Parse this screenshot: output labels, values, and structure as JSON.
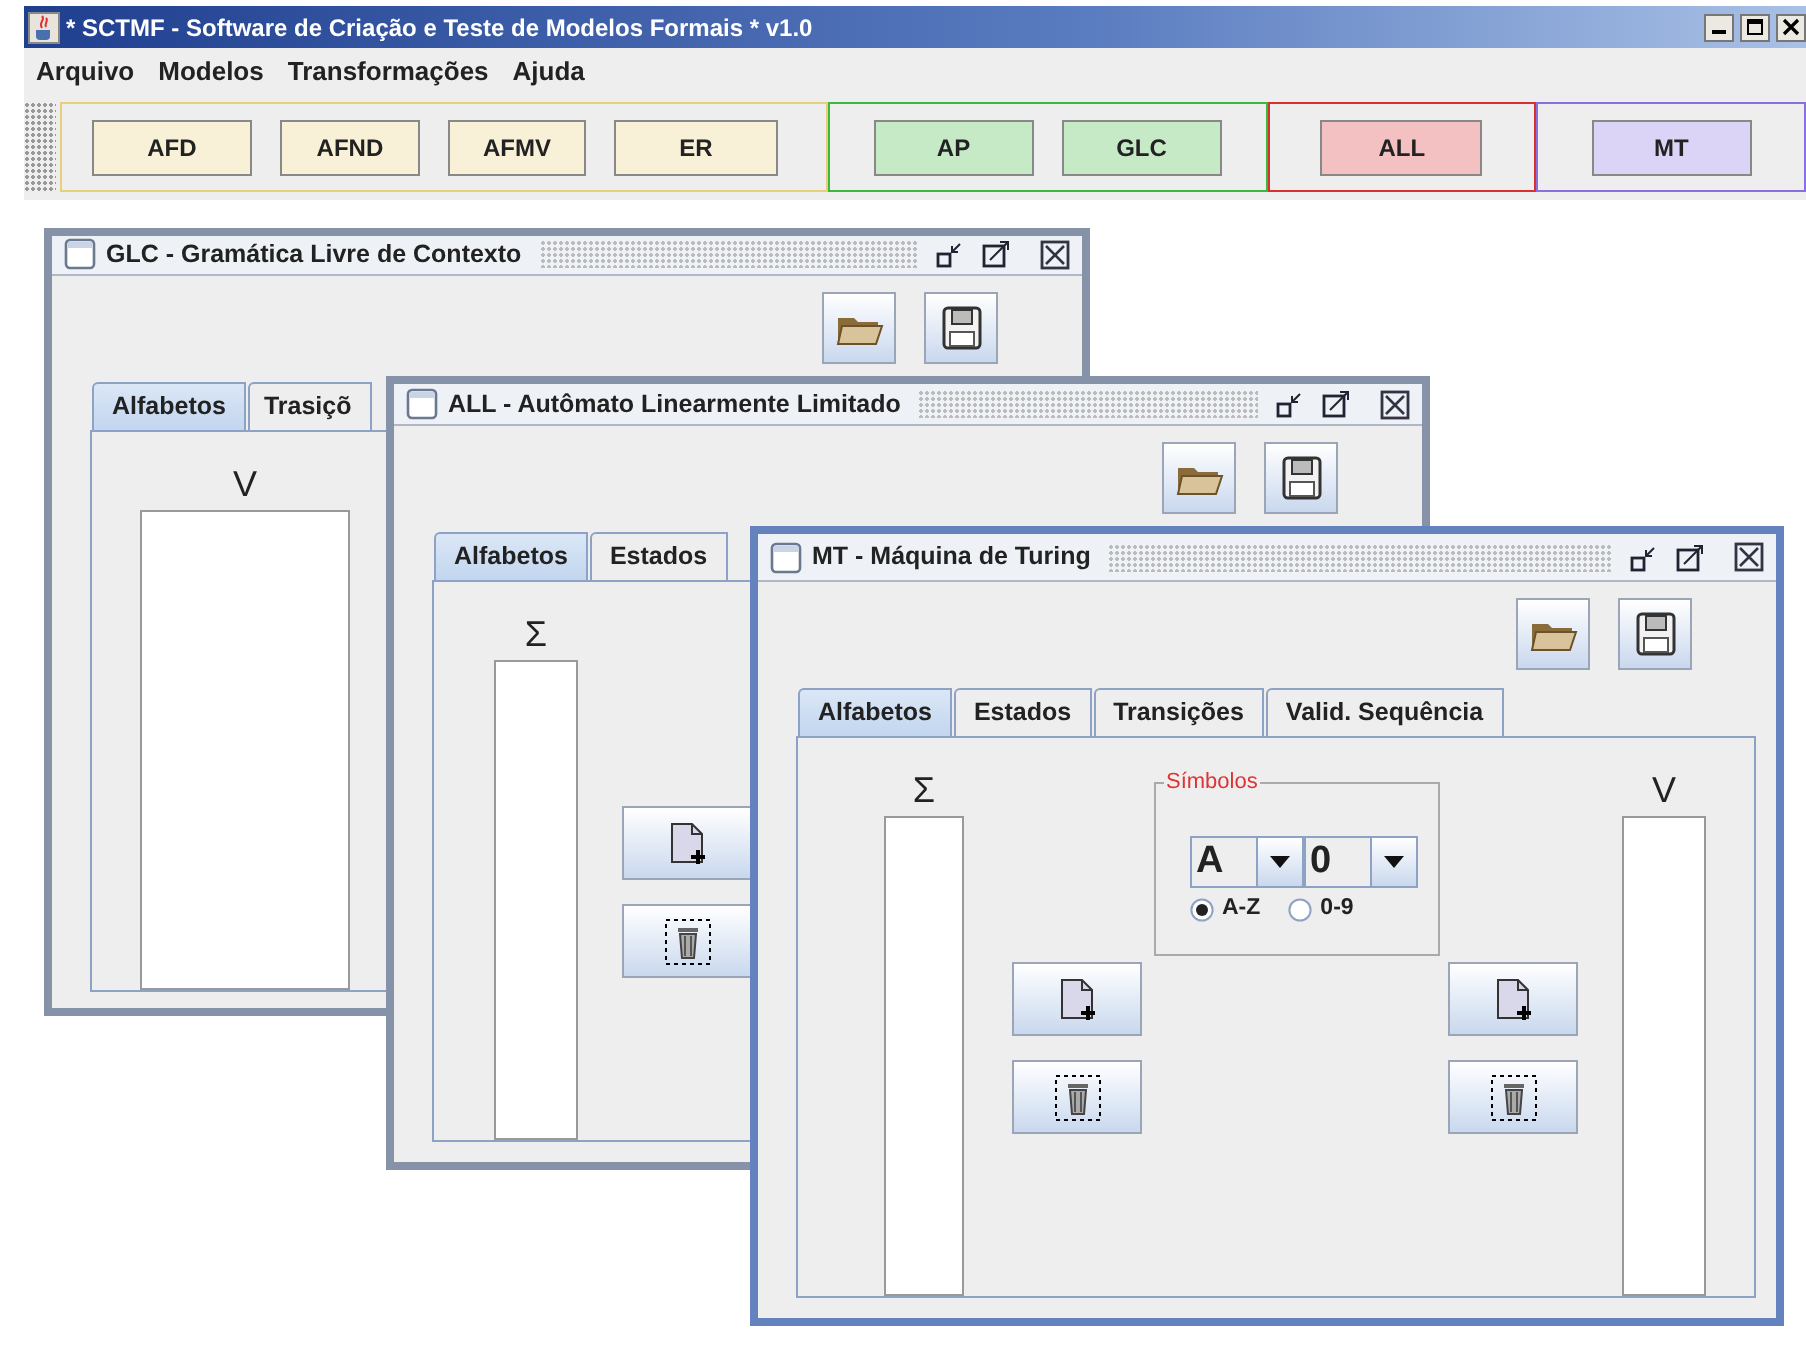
{
  "app": {
    "title": "* SCTMF - Software de Criação e Teste de Modelos Formais * v1.0"
  },
  "menu": [
    "Arquivo",
    "Modelos",
    "Transformações",
    "Ajuda"
  ],
  "toolbar": [
    {
      "color": "#e8cf7a",
      "buttons": [
        "AFD",
        "AFND",
        "AFMV",
        "ER"
      ]
    },
    {
      "color": "#3cb83c",
      "buttons": [
        "AP",
        "GLC"
      ]
    },
    {
      "color": "#d83030",
      "buttons": [
        "ALL"
      ]
    },
    {
      "color": "#8a6fe0",
      "buttons": [
        "MT"
      ]
    }
  ],
  "windows": [
    {
      "title": "GLC - Gramática Livre de Contexto",
      "active": false,
      "tabs": [
        {
          "label": "Alfabetos",
          "selected": true
        },
        {
          "label": "Trasiçõ",
          "selected": false
        }
      ],
      "content": [
        {
          "kind": "list",
          "label": "V"
        }
      ]
    },
    {
      "title": "ALL - Autômato Linearmente Limitado",
      "active": false,
      "tabs": [
        {
          "label": "Alfabetos",
          "selected": true
        },
        {
          "label": "Estados",
          "selected": false
        }
      ],
      "content": [
        {
          "kind": "list",
          "label": "Σ"
        },
        {
          "kind": "buttons"
        }
      ]
    },
    {
      "title": "MT - Máquina de Turing",
      "active": true,
      "tabs": [
        {
          "label": "Alfabetos",
          "selected": true
        },
        {
          "label": "Estados",
          "selected": false
        },
        {
          "label": "Transições",
          "selected": false
        },
        {
          "label": "Valid. Sequência",
          "selected": false
        }
      ],
      "content": [
        {
          "kind": "list",
          "label": "Σ"
        },
        {
          "kind": "buttons"
        },
        {
          "kind": "symbols",
          "legend": "Símbolos",
          "combos": [
            "A",
            "0"
          ],
          "radios": [
            {
              "label": "A-Z",
              "selected": true
            },
            {
              "label": "0-9",
              "selected": false
            }
          ]
        },
        {
          "kind": "buttons"
        },
        {
          "kind": "list",
          "label": "V"
        }
      ]
    }
  ]
}
